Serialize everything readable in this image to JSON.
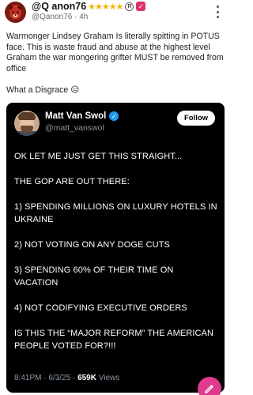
{
  "post": {
    "display_name": "@Q anon76",
    "stars": "★★★★★",
    "registered_mark": "R",
    "verified_mark": "✓",
    "handle": "@Qanon76",
    "time": "4h",
    "paragraphs": [
      "Warmonger Lindsey Graham Is literally spitting in POTUS face. This is waste fraud and abuse at the highest level Graham the war mongering grifter MUST be removed from office",
      "What a Disgrace 😑"
    ]
  },
  "embed": {
    "name": "Matt Van Swol",
    "verified_mark": "✓",
    "handle": "@matt_vanswol",
    "follow_label": "Follow",
    "lines": [
      "OK LET ME JUST GET THIS STRAIGHT...",
      "THE GOP ARE OUT THERE:",
      "1) SPENDING MILLIONS ON LUXURY HOTELS IN UKRAINE",
      "2) NOT VOTING ON ANY DOGE CUTS",
      "3) SPENDING 60% OF THEIR TIME ON VACATION",
      "4) NOT CODIFYING EXECUTIVE ORDERS",
      "IS THIS THE “MAJOR REFORM” THE AMERICAN PEOPLE VOTED FOR?!!!"
    ],
    "time": "8:41PM",
    "date": "6/3/25",
    "views_count": "659K",
    "views_label": "Views"
  },
  "colors": {
    "accent_pink": "#e03a8c",
    "star_gold": "#f5b301",
    "verified_blue": "#1d9bf0",
    "embed_bg": "#000000"
  },
  "icons": {
    "more": "more-vertical-icon",
    "verified": "verified-badge-icon",
    "compose": "pencil-icon"
  }
}
